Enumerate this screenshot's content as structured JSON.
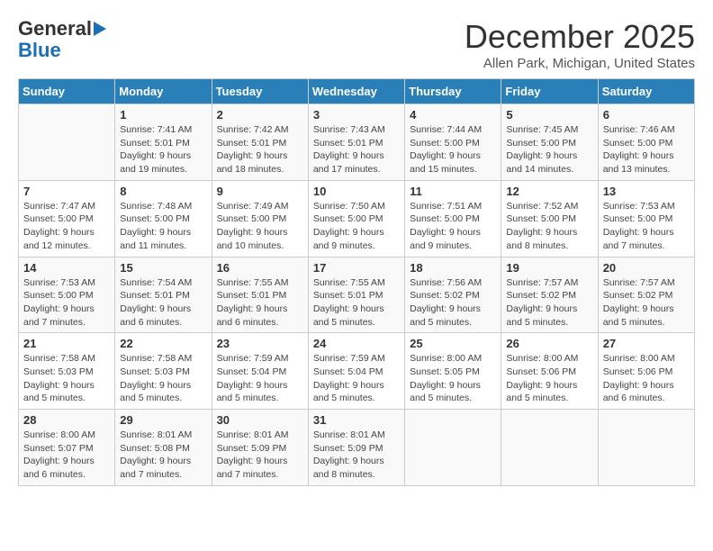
{
  "logo": {
    "line1": "General",
    "line2": "Blue"
  },
  "title": "December 2025",
  "location": "Allen Park, Michigan, United States",
  "weekdays": [
    "Sunday",
    "Monday",
    "Tuesday",
    "Wednesday",
    "Thursday",
    "Friday",
    "Saturday"
  ],
  "weeks": [
    [
      {
        "day": "",
        "info": ""
      },
      {
        "day": "1",
        "info": "Sunrise: 7:41 AM\nSunset: 5:01 PM\nDaylight: 9 hours\nand 19 minutes."
      },
      {
        "day": "2",
        "info": "Sunrise: 7:42 AM\nSunset: 5:01 PM\nDaylight: 9 hours\nand 18 minutes."
      },
      {
        "day": "3",
        "info": "Sunrise: 7:43 AM\nSunset: 5:01 PM\nDaylight: 9 hours\nand 17 minutes."
      },
      {
        "day": "4",
        "info": "Sunrise: 7:44 AM\nSunset: 5:00 PM\nDaylight: 9 hours\nand 15 minutes."
      },
      {
        "day": "5",
        "info": "Sunrise: 7:45 AM\nSunset: 5:00 PM\nDaylight: 9 hours\nand 14 minutes."
      },
      {
        "day": "6",
        "info": "Sunrise: 7:46 AM\nSunset: 5:00 PM\nDaylight: 9 hours\nand 13 minutes."
      }
    ],
    [
      {
        "day": "7",
        "info": "Sunrise: 7:47 AM\nSunset: 5:00 PM\nDaylight: 9 hours\nand 12 minutes."
      },
      {
        "day": "8",
        "info": "Sunrise: 7:48 AM\nSunset: 5:00 PM\nDaylight: 9 hours\nand 11 minutes."
      },
      {
        "day": "9",
        "info": "Sunrise: 7:49 AM\nSunset: 5:00 PM\nDaylight: 9 hours\nand 10 minutes."
      },
      {
        "day": "10",
        "info": "Sunrise: 7:50 AM\nSunset: 5:00 PM\nDaylight: 9 hours\nand 9 minutes."
      },
      {
        "day": "11",
        "info": "Sunrise: 7:51 AM\nSunset: 5:00 PM\nDaylight: 9 hours\nand 9 minutes."
      },
      {
        "day": "12",
        "info": "Sunrise: 7:52 AM\nSunset: 5:00 PM\nDaylight: 9 hours\nand 8 minutes."
      },
      {
        "day": "13",
        "info": "Sunrise: 7:53 AM\nSunset: 5:00 PM\nDaylight: 9 hours\nand 7 minutes."
      }
    ],
    [
      {
        "day": "14",
        "info": "Sunrise: 7:53 AM\nSunset: 5:00 PM\nDaylight: 9 hours\nand 7 minutes."
      },
      {
        "day": "15",
        "info": "Sunrise: 7:54 AM\nSunset: 5:01 PM\nDaylight: 9 hours\nand 6 minutes."
      },
      {
        "day": "16",
        "info": "Sunrise: 7:55 AM\nSunset: 5:01 PM\nDaylight: 9 hours\nand 6 minutes."
      },
      {
        "day": "17",
        "info": "Sunrise: 7:55 AM\nSunset: 5:01 PM\nDaylight: 9 hours\nand 5 minutes."
      },
      {
        "day": "18",
        "info": "Sunrise: 7:56 AM\nSunset: 5:02 PM\nDaylight: 9 hours\nand 5 minutes."
      },
      {
        "day": "19",
        "info": "Sunrise: 7:57 AM\nSunset: 5:02 PM\nDaylight: 9 hours\nand 5 minutes."
      },
      {
        "day": "20",
        "info": "Sunrise: 7:57 AM\nSunset: 5:02 PM\nDaylight: 9 hours\nand 5 minutes."
      }
    ],
    [
      {
        "day": "21",
        "info": "Sunrise: 7:58 AM\nSunset: 5:03 PM\nDaylight: 9 hours\nand 5 minutes."
      },
      {
        "day": "22",
        "info": "Sunrise: 7:58 AM\nSunset: 5:03 PM\nDaylight: 9 hours\nand 5 minutes."
      },
      {
        "day": "23",
        "info": "Sunrise: 7:59 AM\nSunset: 5:04 PM\nDaylight: 9 hours\nand 5 minutes."
      },
      {
        "day": "24",
        "info": "Sunrise: 7:59 AM\nSunset: 5:04 PM\nDaylight: 9 hours\nand 5 minutes."
      },
      {
        "day": "25",
        "info": "Sunrise: 8:00 AM\nSunset: 5:05 PM\nDaylight: 9 hours\nand 5 minutes."
      },
      {
        "day": "26",
        "info": "Sunrise: 8:00 AM\nSunset: 5:06 PM\nDaylight: 9 hours\nand 5 minutes."
      },
      {
        "day": "27",
        "info": "Sunrise: 8:00 AM\nSunset: 5:06 PM\nDaylight: 9 hours\nand 6 minutes."
      }
    ],
    [
      {
        "day": "28",
        "info": "Sunrise: 8:00 AM\nSunset: 5:07 PM\nDaylight: 9 hours\nand 6 minutes."
      },
      {
        "day": "29",
        "info": "Sunrise: 8:01 AM\nSunset: 5:08 PM\nDaylight: 9 hours\nand 7 minutes."
      },
      {
        "day": "30",
        "info": "Sunrise: 8:01 AM\nSunset: 5:09 PM\nDaylight: 9 hours\nand 7 minutes."
      },
      {
        "day": "31",
        "info": "Sunrise: 8:01 AM\nSunset: 5:09 PM\nDaylight: 9 hours\nand 8 minutes."
      },
      {
        "day": "",
        "info": ""
      },
      {
        "day": "",
        "info": ""
      },
      {
        "day": "",
        "info": ""
      }
    ]
  ]
}
